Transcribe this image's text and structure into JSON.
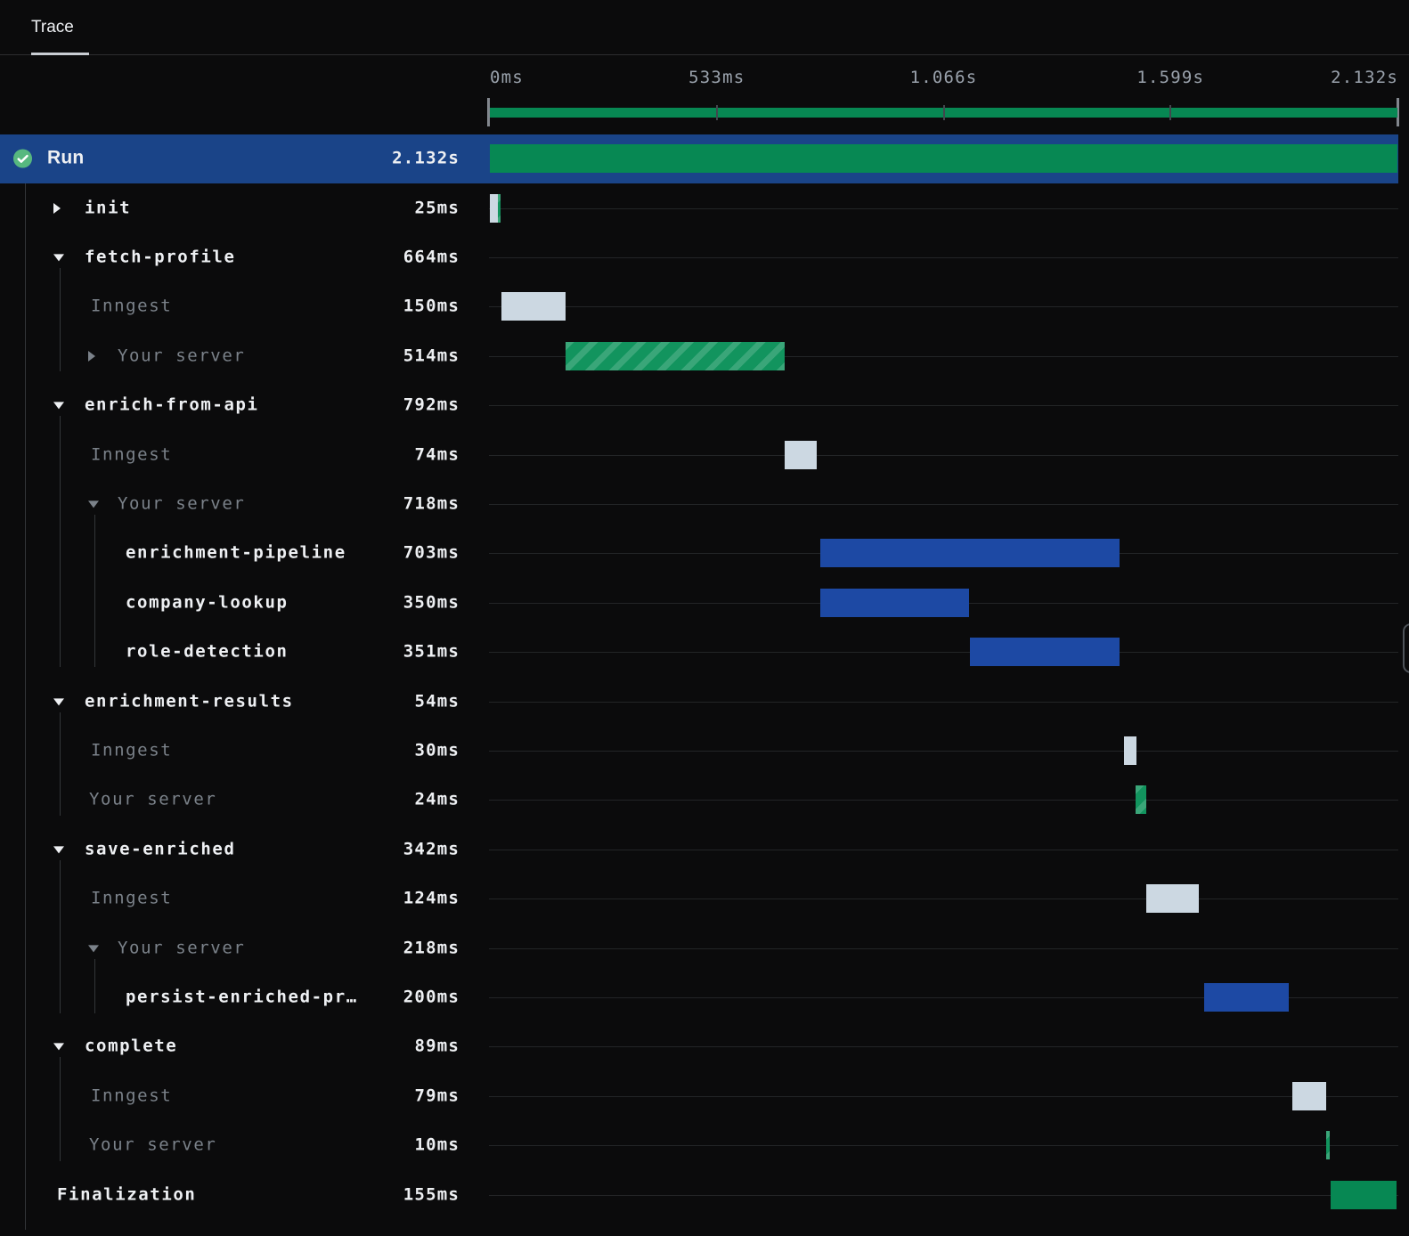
{
  "tab": {
    "label": "Trace"
  },
  "colors": {
    "bg": "#0b0b0c",
    "tabbar-border": "#2d2d2f",
    "tab-underline": "#c9cdd3",
    "text-white": "#eef0f3",
    "text-muted": "#7b828a",
    "axis-label": "#9aa2ac",
    "rowline": "#232527",
    "guide": "#333639",
    "run-row": "#1a4488",
    "blue": "#1d49a4",
    "green": "#078853",
    "green-hatch": "#12945e",
    "light": "#ccd8e2",
    "mm-cap": "#82878e",
    "mm-tick": "#42474e",
    "check-circle": "#57b87f",
    "pill": "#4e5359"
  },
  "chart_data": {
    "type": "gantt-trace",
    "total_ms": 2132,
    "axis_ticks": [
      {
        "ms": 0,
        "label": "0ms",
        "align": "left"
      },
      {
        "ms": 533,
        "label": "533ms",
        "align": "center"
      },
      {
        "ms": 1066,
        "label": "1.066s",
        "align": "center"
      },
      {
        "ms": 1599,
        "label": "1.599s",
        "align": "center"
      },
      {
        "ms": 2132,
        "label": "2.132s",
        "align": "right"
      }
    ]
  },
  "rows": [
    {
      "label": "Run",
      "duration": "2.132s",
      "kind": "run",
      "status_icon": "check-success",
      "selected": true,
      "bars": [
        {
          "start": 0,
          "dur": 2132,
          "style": "green"
        }
      ]
    },
    {
      "label": "init",
      "duration": "25ms",
      "kind": "step",
      "toggle": "collapsed",
      "bars": [
        {
          "start": 0,
          "dur": 19,
          "style": "light"
        },
        {
          "start": 19,
          "dur": 7,
          "style": "green-hatched"
        }
      ]
    },
    {
      "label": "fetch-profile",
      "duration": "664ms",
      "kind": "step",
      "toggle": "expanded",
      "bars": []
    },
    {
      "label": "Inngest",
      "duration": "150ms",
      "kind": "inngest",
      "bars": [
        {
          "start": 27,
          "dur": 150,
          "style": "light"
        }
      ]
    },
    {
      "label": "Your server",
      "duration": "514ms",
      "kind": "server",
      "toggle": "collapsed",
      "bars": [
        {
          "start": 178,
          "dur": 514,
          "style": "green-hatched"
        }
      ]
    },
    {
      "label": "enrich-from-api",
      "duration": "792ms",
      "kind": "step",
      "toggle": "expanded",
      "bars": []
    },
    {
      "label": "Inngest",
      "duration": "74ms",
      "kind": "inngest",
      "bars": [
        {
          "start": 693,
          "dur": 74,
          "style": "light"
        }
      ]
    },
    {
      "label": "Your server",
      "duration": "718ms",
      "kind": "server",
      "toggle": "expanded",
      "bars": []
    },
    {
      "label": "enrichment-pipeline",
      "duration": "703ms",
      "kind": "substep",
      "bars": [
        {
          "start": 776,
          "dur": 703,
          "style": "blue"
        }
      ]
    },
    {
      "label": "company-lookup",
      "duration": "350ms",
      "kind": "substep",
      "bars": [
        {
          "start": 776,
          "dur": 350,
          "style": "blue"
        }
      ]
    },
    {
      "label": "role-detection",
      "duration": "351ms",
      "kind": "substep",
      "bars": [
        {
          "start": 1128,
          "dur": 351,
          "style": "blue"
        }
      ]
    },
    {
      "label": "enrichment-results",
      "duration": "54ms",
      "kind": "step",
      "toggle": "expanded",
      "bars": []
    },
    {
      "label": "Inngest",
      "duration": "30ms",
      "kind": "inngest",
      "bars": [
        {
          "start": 1490,
          "dur": 30,
          "style": "light"
        }
      ]
    },
    {
      "label": "Your server",
      "duration": "24ms",
      "kind": "server-leaf",
      "bars": [
        {
          "start": 1517,
          "dur": 24,
          "style": "green-hatched"
        }
      ]
    },
    {
      "label": "save-enriched",
      "duration": "342ms",
      "kind": "step",
      "toggle": "expanded",
      "bars": []
    },
    {
      "label": "Inngest",
      "duration": "124ms",
      "kind": "inngest",
      "bars": [
        {
          "start": 1541,
          "dur": 124,
          "style": "light"
        }
      ]
    },
    {
      "label": "Your server",
      "duration": "218ms",
      "kind": "server",
      "toggle": "expanded",
      "bars": []
    },
    {
      "label": "persist-enriched-pr…",
      "duration": "200ms",
      "kind": "substep",
      "bars": [
        {
          "start": 1677,
          "dur": 200,
          "style": "blue"
        }
      ]
    },
    {
      "label": "complete",
      "duration": "89ms",
      "kind": "step",
      "toggle": "expanded",
      "bars": []
    },
    {
      "label": "Inngest",
      "duration": "79ms",
      "kind": "inngest",
      "bars": [
        {
          "start": 1885,
          "dur": 79,
          "style": "light"
        }
      ]
    },
    {
      "label": "Your server",
      "duration": "10ms",
      "kind": "server-leaf",
      "bars": [
        {
          "start": 1964,
          "dur": 10,
          "style": "green-hatched"
        }
      ]
    },
    {
      "label": "Finalization",
      "duration": "155ms",
      "kind": "finalization",
      "bars": [
        {
          "start": 1975,
          "dur": 155,
          "style": "green"
        }
      ]
    }
  ]
}
